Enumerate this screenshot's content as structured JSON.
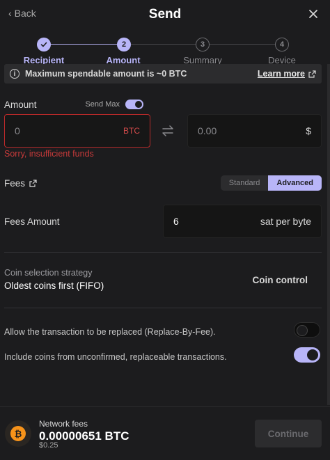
{
  "header": {
    "back_label": "Back",
    "title": "Send"
  },
  "stepper": {
    "steps": [
      {
        "number": "1",
        "label": "Recipient",
        "state": "done"
      },
      {
        "number": "2",
        "label": "Amount",
        "state": "active"
      },
      {
        "number": "3",
        "label": "Summary",
        "state": "todo"
      },
      {
        "number": "4",
        "label": "Device",
        "state": "todo"
      }
    ]
  },
  "banner": {
    "text": "Maximum spendable amount is ~0 BTC",
    "link_label": "Learn more"
  },
  "amount": {
    "label": "Amount",
    "send_max_label": "Send Max",
    "send_max_on": true,
    "crypto_value": "0",
    "crypto_unit": "BTC",
    "fiat_value": "0.00",
    "fiat_unit": "$",
    "error": "Sorry, insufficient funds"
  },
  "fees": {
    "label": "Fees",
    "modes": [
      "Standard",
      "Advanced"
    ],
    "selected_mode": "Advanced",
    "amount_label": "Fees Amount",
    "amount_value": "6",
    "amount_unit": "sat per byte"
  },
  "coin_selection": {
    "label": "Coin selection strategy",
    "value": "Oldest coins first (FIFO)",
    "control_label": "Coin control"
  },
  "options": [
    {
      "label": "Allow the transaction to be replaced (Replace-By-Fee).",
      "on": false
    },
    {
      "label": "Include coins from unconfirmed, replaceable transactions.",
      "on": true
    }
  ],
  "footer": {
    "network_fees_label": "Network fees",
    "btc_amount": "0.00000651 BTC",
    "fiat_amount": "$0.25",
    "coin_symbol": "₿",
    "continue_label": "Continue"
  },
  "colors": {
    "accent": "#b8b5f8",
    "error": "#c63a3a",
    "background": "#1c1c1e",
    "bitcoin": "#f7931a"
  }
}
